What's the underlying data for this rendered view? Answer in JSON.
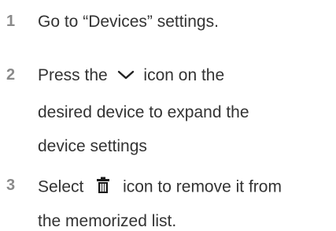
{
  "steps": [
    {
      "number": "1",
      "lines": [
        "Go to “Devices” settings."
      ]
    },
    {
      "number": "2",
      "line1_before": "Press the",
      "icon": "chevron-down-icon",
      "line1_after": "icon on the",
      "line2": "desired device to expand the",
      "line3": "device settings"
    },
    {
      "number": "3",
      "line1_before": "Select",
      "icon": "trash-icon",
      "line1_after": "icon to remove it from",
      "line2": "the memorized list."
    }
  ]
}
